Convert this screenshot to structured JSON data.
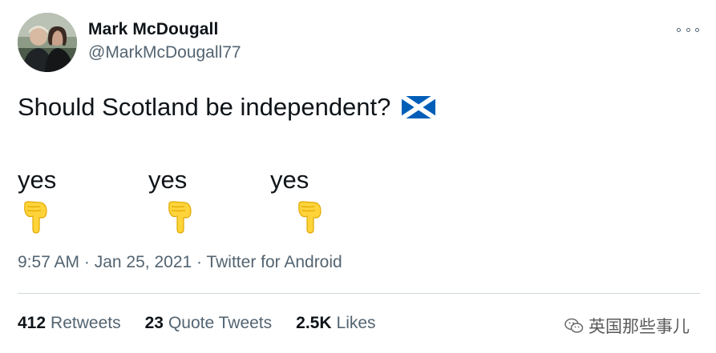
{
  "author": {
    "name": "Mark McDougall",
    "handle": "@MarkMcDougall77"
  },
  "tweet": {
    "text": "Should Scotland be independent?",
    "flag_icon": "scotland-flag-icon",
    "choices": [
      "yes",
      "yes",
      "yes"
    ],
    "pointing_icon": "backhand-index-pointing-down-icon"
  },
  "meta": {
    "time": "9:57 AM",
    "separator1": " · ",
    "date": "Jan 25, 2021",
    "separator2": " · ",
    "source": "Twitter for Android"
  },
  "stats": {
    "retweets": {
      "count": "412",
      "label": "Retweets"
    },
    "quotes": {
      "count": "23",
      "label": "Quote Tweets"
    },
    "likes": {
      "count": "2.5K",
      "label": "Likes"
    }
  },
  "watermark": {
    "text": "英国那些事儿",
    "icon": "wechat-icon"
  },
  "colors": {
    "text_primary": "#0f1419",
    "text_secondary": "#536471",
    "divider": "#cfd9de",
    "flag_blue": "#005eb8",
    "emoji_yellow": "#ffd43b"
  }
}
